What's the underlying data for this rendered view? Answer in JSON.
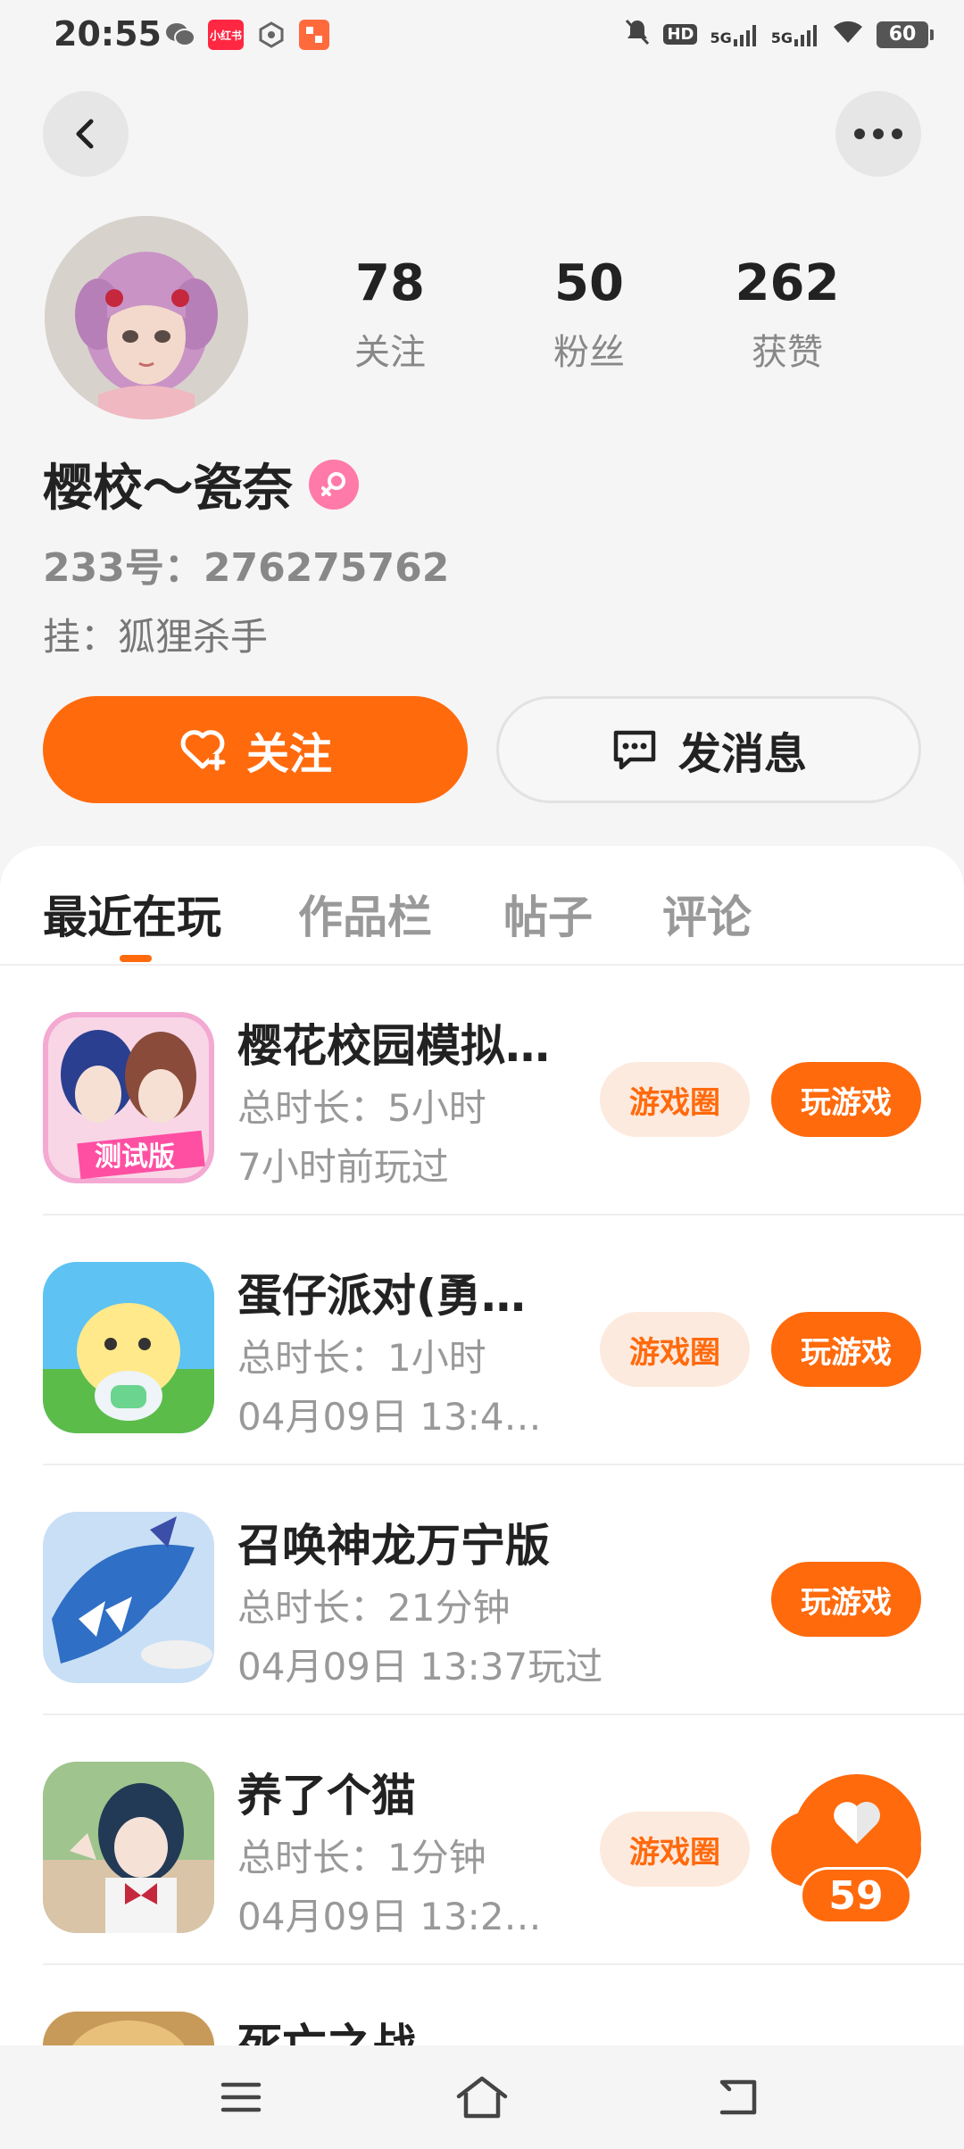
{
  "status_bar": {
    "time": "20:55",
    "apps": [
      {
        "name": "wechat-icon",
        "label": "",
        "color": "#6b6b6b"
      },
      {
        "name": "xiaohongshu-icon",
        "label": "小红书",
        "color": "#ff2742"
      },
      {
        "name": "hexagon-icon",
        "label": "",
        "color": "#6b6b6b"
      },
      {
        "name": "app-icon",
        "label": "",
        "color": "#ff6a3d"
      }
    ],
    "network1": "5G",
    "network2": "5G",
    "hd": "HD",
    "battery": "60"
  },
  "profile": {
    "name": "樱校～瓷奈",
    "uid": "233号：276275762",
    "sign": "挂：狐狸杀手",
    "stats": [
      {
        "value": "78",
        "label": "关注"
      },
      {
        "value": "50",
        "label": "粉丝"
      },
      {
        "value": "262",
        "label": "获赞"
      }
    ]
  },
  "actions": {
    "follow": "关注",
    "message": "发消息"
  },
  "tabs": [
    "最近在玩",
    "作品栏",
    "帖子",
    "评论"
  ],
  "games": [
    {
      "title": "樱花校园模拟…",
      "duration": "总时长：5小时",
      "last_played": "7小时前玩过",
      "circle": "游戏圈",
      "play": "玩游戏"
    },
    {
      "title": "蛋仔派对(勇…",
      "duration": "总时长：1小时",
      "last_played": "04月09日  13:4…",
      "circle": "游戏圈",
      "play": "玩游戏"
    },
    {
      "title": "召唤神龙万宁版",
      "duration": "总时长：21分钟",
      "last_played": "04月09日  13:37玩过",
      "circle": "",
      "play": "玩游戏"
    },
    {
      "title": "养了个猫",
      "duration": "总时长：1分钟",
      "last_played": "04月09日  13:2…",
      "circle": "游戏圈",
      "play": "玩游戏"
    },
    {
      "title": "死亡之战",
      "duration": "",
      "last_played": "",
      "circle": "",
      "play": ""
    }
  ],
  "float_like": {
    "count": "59"
  },
  "colors": {
    "accent": "#ff6a0d",
    "accent_light": "#fdeade",
    "female": "#ff7aa8"
  }
}
